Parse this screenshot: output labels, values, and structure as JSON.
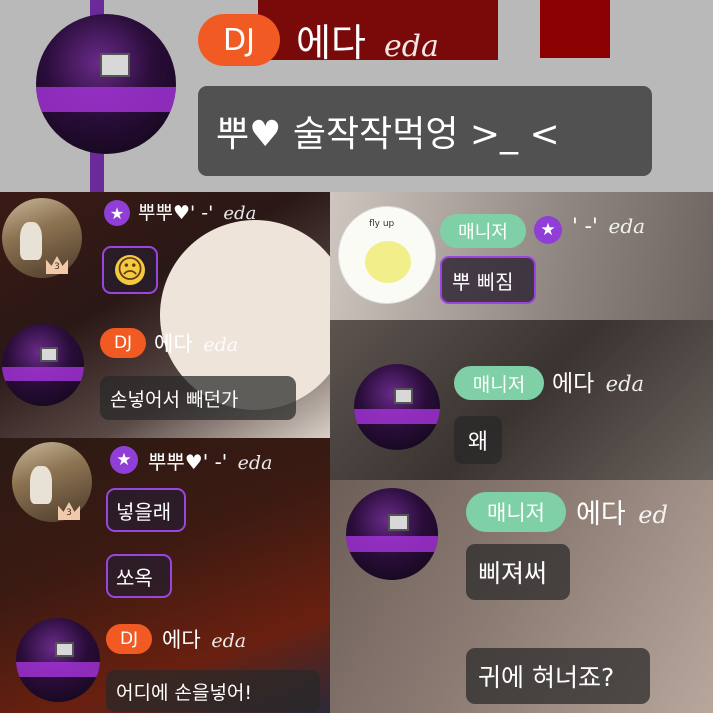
{
  "top": {
    "badge": "DJ",
    "name": "에다",
    "name_script": "eda",
    "message": "뿌♥ 술작작먹엉 >_ <"
  },
  "panel_a": {
    "msg1": {
      "name": "뿌뿌♥' -'",
      "name_script": "eda",
      "rank": "3",
      "emoji": "☹"
    },
    "msg2": {
      "badge": "DJ",
      "name": "에다",
      "name_script": "eda",
      "message": "손넣어서 빼던가"
    }
  },
  "panel_b": {
    "badge": "매니저",
    "name": "' -'",
    "name_script": "eda",
    "message": "뿌 삐짐",
    "avatar_text": "fly up"
  },
  "panel_c": {
    "badge": "매니저",
    "name": "에다",
    "name_script": "eda",
    "message": "왜"
  },
  "panel_d": {
    "msg1": {
      "name": "뿌뿌♥' -'",
      "name_script": "eda",
      "rank": "3",
      "messages": [
        "넣을래",
        "쏘옥"
      ]
    },
    "msg2": {
      "badge": "DJ",
      "name": "에다",
      "name_script": "eda",
      "message": "어디에 손을넣어!"
    }
  },
  "panel_e": {
    "badge": "매니저",
    "name": "에다",
    "name_script": "ed",
    "messages": [
      "삐져써",
      "귀에 혀너죠?"
    ]
  },
  "colors": {
    "dj": "#f15a22",
    "manager": "#7fd0a6",
    "star": "#8f3fd6",
    "outline": "#9b45e0"
  }
}
